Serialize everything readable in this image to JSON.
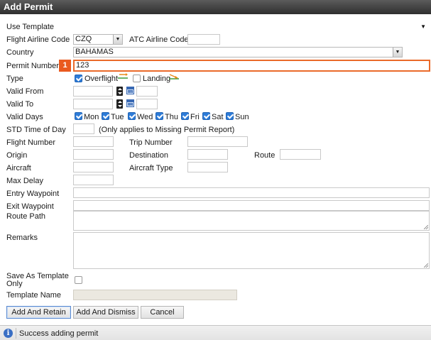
{
  "window": {
    "title": "Add Permit"
  },
  "form": {
    "use_template": {
      "label": "Use Template",
      "value": ""
    },
    "flight_airline_code": {
      "label": "Flight Airline Code",
      "value": "CZQ"
    },
    "atc_airline_code": {
      "label": "ATC Airline Code",
      "value": ""
    },
    "country": {
      "label": "Country",
      "value": "BAHAMAS"
    },
    "permit_number": {
      "label": "Permit Number",
      "value": "123",
      "badge": "1"
    },
    "type": {
      "label": "Type",
      "overflight": "Overflight",
      "landing": "Landing",
      "overflight_checked": true,
      "landing_checked": false
    },
    "valid_from": {
      "label": "Valid From"
    },
    "valid_to": {
      "label": "Valid To"
    },
    "valid_days": {
      "label": "Valid Days",
      "days": [
        "Mon",
        "Tue",
        "Wed",
        "Thu",
        "Fri",
        "Sat",
        "Sun"
      ]
    },
    "std_time_of_day": {
      "label": "STD Time of Day",
      "note": "(Only applies to Missing Permit Report)"
    },
    "flight_number": {
      "label": "Flight Number"
    },
    "trip_number": {
      "label": "Trip Number"
    },
    "origin": {
      "label": "Origin"
    },
    "destination": {
      "label": "Destination"
    },
    "route": {
      "label": "Route"
    },
    "aircraft": {
      "label": "Aircraft"
    },
    "aircraft_type": {
      "label": "Aircraft Type"
    },
    "max_delay": {
      "label": "Max Delay"
    },
    "entry_waypoint": {
      "label": "Entry Waypoint"
    },
    "exit_waypoint": {
      "label": "Exit Waypoint"
    },
    "route_path": {
      "label": "Route Path"
    },
    "remarks": {
      "label": "Remarks"
    },
    "save_as_template": {
      "label_line1": "Save As Template",
      "label_line2": "Only",
      "checked": false
    },
    "template_name": {
      "label": "Template Name"
    }
  },
  "buttons": {
    "add_and_retain": "Add And Retain",
    "add_and_dismiss": "Add And Dismiss",
    "cancel": "Cancel"
  },
  "status": {
    "message": "Success adding permit",
    "icon": "info-icon"
  },
  "colors": {
    "highlight": "#ea6a2a",
    "checkbox": "#2e7cd8"
  }
}
